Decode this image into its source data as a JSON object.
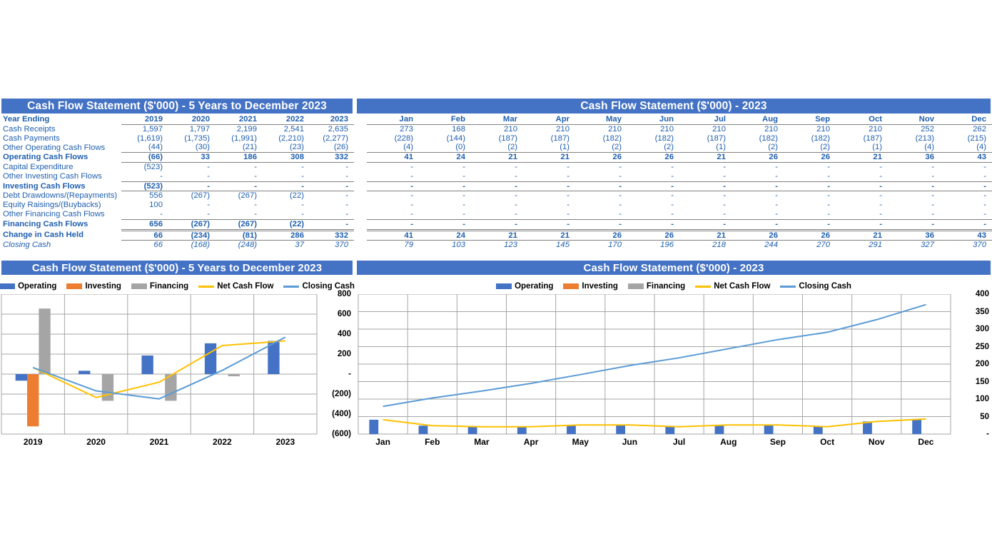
{
  "annual_table": {
    "title": "Cash Flow Statement ($'000) - 5 Years to December 2023",
    "row_header": "Year Ending",
    "columns": [
      "2019",
      "2020",
      "2021",
      "2022",
      "2023"
    ],
    "rows": [
      {
        "label": "Cash Receipts",
        "values": [
          "1,597",
          "1,797",
          "2,199",
          "2,541",
          "2,635"
        ],
        "style": "normal"
      },
      {
        "label": "Cash Payments",
        "values": [
          "(1,619)",
          "(1,735)",
          "(1,991)",
          "(2,210)",
          "(2,277)"
        ],
        "style": "normal"
      },
      {
        "label": "Other Operating Cash Flows",
        "values": [
          "(44)",
          "(30)",
          "(21)",
          "(23)",
          "(26)"
        ],
        "style": "normal"
      },
      {
        "label": "Operating Cash Flows",
        "values": [
          "(66)",
          "33",
          "186",
          "308",
          "332"
        ],
        "style": "bold"
      },
      {
        "label": "Capital Expenditure",
        "values": [
          "(523)",
          "-",
          "-",
          "-",
          "-"
        ],
        "style": "normal"
      },
      {
        "label": "Other Investing Cash Flows",
        "values": [
          "-",
          "-",
          "-",
          "-",
          "-"
        ],
        "style": "normal"
      },
      {
        "label": "Investing Cash Flows",
        "values": [
          "(523)",
          "-",
          "-",
          "-",
          "-"
        ],
        "style": "bold"
      },
      {
        "label": "Debt Drawdowns/(Repayments)",
        "values": [
          "556",
          "(267)",
          "(267)",
          "(22)",
          "-"
        ],
        "style": "normal"
      },
      {
        "label": "Equity Raisings/(Buybacks)",
        "values": [
          "100",
          "-",
          "-",
          "-",
          "-"
        ],
        "style": "normal"
      },
      {
        "label": "Other Financing Cash Flows",
        "values": [
          "-",
          "-",
          "-",
          "-",
          "-"
        ],
        "style": "normal"
      },
      {
        "label": "Financing Cash Flows",
        "values": [
          "656",
          "(267)",
          "(267)",
          "(22)",
          "-"
        ],
        "style": "bold"
      },
      {
        "label": "Change in Cash Held",
        "values": [
          "66",
          "(234)",
          "(81)",
          "286",
          "332"
        ],
        "style": "bold"
      },
      {
        "label": "Closing Cash",
        "values": [
          "66",
          "(168)",
          "(248)",
          "37",
          "370"
        ],
        "style": "italic"
      }
    ]
  },
  "monthly_table": {
    "title": "Cash Flow Statement ($'000) - 2023",
    "row_header": "",
    "columns": [
      "Jan",
      "Feb",
      "Mar",
      "Apr",
      "May",
      "Jun",
      "Jul",
      "Aug",
      "Sep",
      "Oct",
      "Nov",
      "Dec"
    ],
    "rows": [
      {
        "label": "Cash Receipts",
        "values": [
          "273",
          "168",
          "210",
          "210",
          "210",
          "210",
          "210",
          "210",
          "210",
          "210",
          "252",
          "262"
        ],
        "style": "normal"
      },
      {
        "label": "Cash Payments",
        "values": [
          "(228)",
          "(144)",
          "(187)",
          "(187)",
          "(182)",
          "(182)",
          "(187)",
          "(182)",
          "(182)",
          "(187)",
          "(213)",
          "(215)"
        ],
        "style": "normal"
      },
      {
        "label": "Other Operating Cash Flows",
        "values": [
          "(4)",
          "(0)",
          "(2)",
          "(1)",
          "(2)",
          "(2)",
          "(1)",
          "(2)",
          "(2)",
          "(1)",
          "(4)",
          "(4)"
        ],
        "style": "normal"
      },
      {
        "label": "Operating Cash Flows",
        "values": [
          "41",
          "24",
          "21",
          "21",
          "26",
          "26",
          "21",
          "26",
          "26",
          "21",
          "36",
          "43"
        ],
        "style": "bold"
      },
      {
        "label": "Capital Expenditure",
        "values": [
          "-",
          "-",
          "-",
          "-",
          "-",
          "-",
          "-",
          "-",
          "-",
          "-",
          "-",
          "-"
        ],
        "style": "normal"
      },
      {
        "label": "Other Investing Cash Flows",
        "values": [
          "-",
          "-",
          "-",
          "-",
          "-",
          "-",
          "-",
          "-",
          "-",
          "-",
          "-",
          "-"
        ],
        "style": "normal"
      },
      {
        "label": "Investing Cash Flows",
        "values": [
          "-",
          "-",
          "-",
          "-",
          "-",
          "-",
          "-",
          "-",
          "-",
          "-",
          "-",
          "-"
        ],
        "style": "bold"
      },
      {
        "label": "Debt Drawdowns/(Repayments)",
        "values": [
          "-",
          "-",
          "-",
          "-",
          "-",
          "-",
          "-",
          "-",
          "-",
          "-",
          "-",
          "-"
        ],
        "style": "normal"
      },
      {
        "label": "Equity Raisings/(Buybacks)",
        "values": [
          "-",
          "-",
          "-",
          "-",
          "-",
          "-",
          "-",
          "-",
          "-",
          "-",
          "-",
          "-"
        ],
        "style": "normal"
      },
      {
        "label": "Other Financing Cash Flows",
        "values": [
          "-",
          "-",
          "-",
          "-",
          "-",
          "-",
          "-",
          "-",
          "-",
          "-",
          "-",
          "-"
        ],
        "style": "normal"
      },
      {
        "label": "Financing Cash Flows",
        "values": [
          "-",
          "-",
          "-",
          "-",
          "-",
          "-",
          "-",
          "-",
          "-",
          "-",
          "-",
          "-"
        ],
        "style": "bold"
      },
      {
        "label": "Change in Cash Held",
        "values": [
          "41",
          "24",
          "21",
          "21",
          "26",
          "26",
          "21",
          "26",
          "26",
          "21",
          "36",
          "43"
        ],
        "style": "bold"
      },
      {
        "label": "Closing Cash",
        "values": [
          "79",
          "103",
          "123",
          "145",
          "170",
          "196",
          "218",
          "244",
          "270",
          "291",
          "327",
          "370"
        ],
        "style": "italic"
      }
    ]
  },
  "colors": {
    "header_blue": "#4472C4",
    "operating": "#4472C4",
    "investing": "#ED7D31",
    "financing": "#A5A5A5",
    "net_cash_flow": "#FFC000",
    "closing_cash": "#5B9BD5",
    "table_text": "#1F5FB0",
    "gridline": "#A6A6A6"
  },
  "legend": {
    "items": [
      {
        "label": "Operating",
        "color": "#4472C4",
        "kind": "bar"
      },
      {
        "label": "Investing",
        "color": "#ED7D31",
        "kind": "bar"
      },
      {
        "label": "Financing",
        "color": "#A5A5A5",
        "kind": "bar"
      },
      {
        "label": "Net Cash Flow",
        "color": "#FFC000",
        "kind": "line"
      },
      {
        "label": "Closing Cash",
        "color": "#5B9BD5",
        "kind": "line"
      }
    ]
  },
  "chart_data": [
    {
      "type": "bar",
      "id": "annual-chart",
      "title": "Cash Flow Statement ($'000) - 5 Years to December 2023",
      "categories": [
        "2019",
        "2020",
        "2021",
        "2022",
        "2023"
      ],
      "series": [
        {
          "name": "Operating",
          "kind": "bar",
          "color": "#4472C4",
          "values": [
            -66,
            33,
            186,
            308,
            332
          ]
        },
        {
          "name": "Investing",
          "kind": "bar",
          "color": "#ED7D31",
          "values": [
            -523,
            0,
            0,
            0,
            0
          ]
        },
        {
          "name": "Financing",
          "kind": "bar",
          "color": "#A5A5A5",
          "values": [
            656,
            -267,
            -267,
            -22,
            0
          ]
        },
        {
          "name": "Net Cash Flow",
          "kind": "line",
          "color": "#FFC000",
          "values": [
            66,
            -234,
            -81,
            286,
            332
          ]
        },
        {
          "name": "Closing Cash",
          "kind": "line",
          "color": "#5B9BD5",
          "values": [
            66,
            -168,
            -248,
            37,
            370
          ]
        }
      ],
      "ylim": [
        -600,
        800
      ],
      "yticks": [
        800,
        600,
        400,
        200,
        0,
        -200,
        -400,
        -600
      ],
      "yticklabels": [
        "800",
        "600",
        "400",
        "200",
        "-",
        "(200)",
        "(400)",
        "(600)"
      ],
      "xlabel": "",
      "ylabel": "",
      "grid": true,
      "legend_position": "top"
    },
    {
      "type": "bar",
      "id": "monthly-chart",
      "title": "Cash Flow Statement ($'000) - 2023",
      "categories": [
        "Jan",
        "Feb",
        "Mar",
        "Apr",
        "May",
        "Jun",
        "Jul",
        "Aug",
        "Sep",
        "Oct",
        "Nov",
        "Dec"
      ],
      "series": [
        {
          "name": "Operating",
          "kind": "bar",
          "color": "#4472C4",
          "values": [
            41,
            24,
            21,
            21,
            26,
            26,
            21,
            26,
            26,
            21,
            36,
            43
          ]
        },
        {
          "name": "Investing",
          "kind": "bar",
          "color": "#ED7D31",
          "values": [
            0,
            0,
            0,
            0,
            0,
            0,
            0,
            0,
            0,
            0,
            0,
            0
          ]
        },
        {
          "name": "Financing",
          "kind": "bar",
          "color": "#A5A5A5",
          "values": [
            0,
            0,
            0,
            0,
            0,
            0,
            0,
            0,
            0,
            0,
            0,
            0
          ]
        },
        {
          "name": "Net Cash Flow",
          "kind": "line",
          "color": "#FFC000",
          "values": [
            41,
            24,
            21,
            21,
            26,
            26,
            21,
            26,
            26,
            21,
            36,
            43
          ]
        },
        {
          "name": "Closing Cash",
          "kind": "line",
          "color": "#5B9BD5",
          "values": [
            79,
            103,
            123,
            145,
            170,
            196,
            218,
            244,
            270,
            291,
            327,
            370
          ]
        }
      ],
      "ylim": [
        0,
        400
      ],
      "yticks": [
        400,
        350,
        300,
        250,
        200,
        150,
        100,
        50,
        0
      ],
      "yticklabels": [
        "400",
        "350",
        "300",
        "250",
        "200",
        "150",
        "100",
        "50",
        "-"
      ],
      "xlabel": "",
      "ylabel": "",
      "grid": true,
      "legend_position": "top"
    }
  ]
}
